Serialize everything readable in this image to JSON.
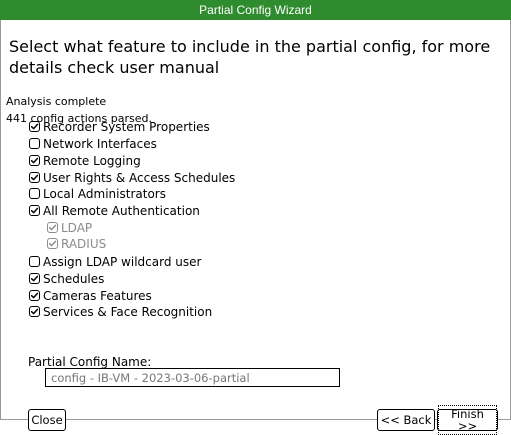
{
  "window": {
    "title": "Partial Config Wizard",
    "instructions": "Select what feature to include in the partial config, for more details check user manual",
    "status_line1": "Analysis complete",
    "status_line2": "441 config actions parsed."
  },
  "options": [
    {
      "label": "Recorder System Properties",
      "checked": true
    },
    {
      "label": "Network Interfaces",
      "checked": false
    },
    {
      "label": "Remote Logging",
      "checked": true
    },
    {
      "label": "User Rights & Access Schedules",
      "checked": true
    },
    {
      "label": "Local Administrators",
      "checked": false
    },
    {
      "label": "All Remote Authentication",
      "checked": true
    },
    {
      "label": "LDAP",
      "checked": true,
      "disabled": true
    },
    {
      "label": "RADIUS",
      "checked": true,
      "disabled": true
    },
    {
      "label": "Assign LDAP wildcard user",
      "checked": false
    },
    {
      "label": "Schedules",
      "checked": true
    },
    {
      "label": "Cameras Features",
      "checked": true
    },
    {
      "label": "Services & Face Recognition",
      "checked": true
    }
  ],
  "config_name": {
    "label": "Partial Config Name:",
    "value": "config - IB-VM - 2023-03-06-partial"
  },
  "buttons": {
    "close": "Close",
    "back": "<< Back",
    "finish": "Finish >>"
  }
}
